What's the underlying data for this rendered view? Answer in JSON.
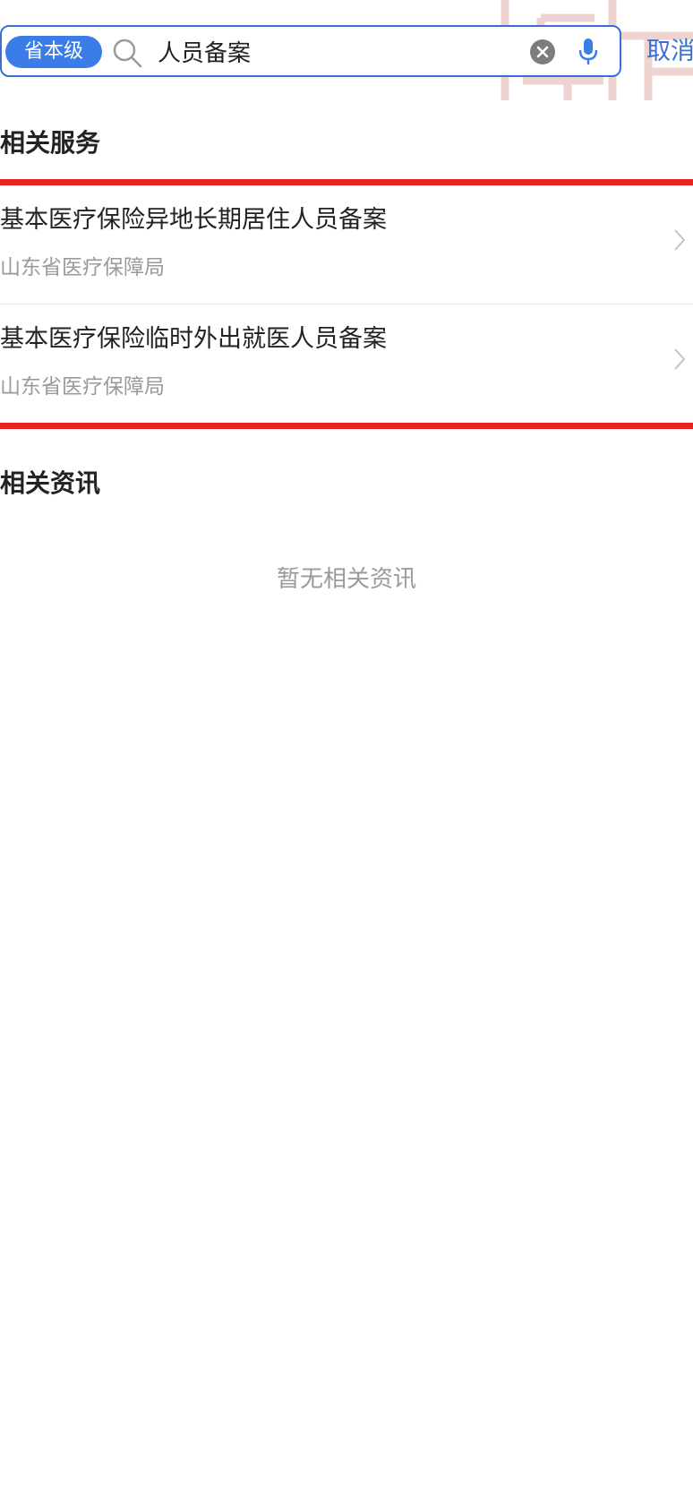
{
  "search": {
    "scope_label": "省本级",
    "query": "人员备案",
    "cancel_label": "取消"
  },
  "services": {
    "title": "相关服务",
    "items": [
      {
        "title": "基本医疗保险异地长期居住人员备案",
        "subtitle": "山东省医疗保障局"
      },
      {
        "title": "基本医疗保险临时外出就医人员备案",
        "subtitle": "山东省医疗保障局"
      }
    ]
  },
  "news": {
    "title": "相关资讯",
    "empty_text": "暂无相关资讯"
  },
  "colors": {
    "accent": "#3b6fd4",
    "pill": "#3a7ce8",
    "highlight_red": "#e8241c",
    "secondary_text": "#9a9a9a",
    "watermark": "#e9c7c4"
  }
}
